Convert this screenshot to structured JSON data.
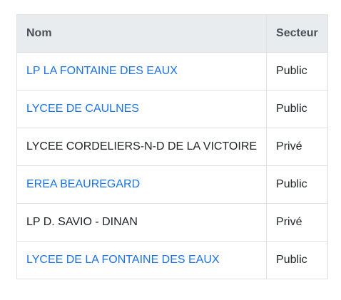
{
  "table": {
    "headers": {
      "name": "Nom",
      "sector": "Secteur"
    },
    "rows": [
      {
        "name": "LP LA FONTAINE DES EAUX",
        "sector": "Public",
        "is_link": true
      },
      {
        "name": "LYCEE DE CAULNES",
        "sector": "Public",
        "is_link": true
      },
      {
        "name": "LYCEE CORDELIERS-N-D DE LA VICTOIRE",
        "sector": "Privé",
        "is_link": false
      },
      {
        "name": "EREA BEAUREGARD",
        "sector": "Public",
        "is_link": true
      },
      {
        "name": "LP D. SAVIO - DINAN",
        "sector": "Privé",
        "is_link": false
      },
      {
        "name": "LYCEE DE LA FONTAINE DES EAUX",
        "sector": "Public",
        "is_link": true
      }
    ]
  },
  "colors": {
    "link": "#1a73e8",
    "header_bg": "#e9ecef",
    "border": "#dee2e6",
    "text": "#212529"
  }
}
